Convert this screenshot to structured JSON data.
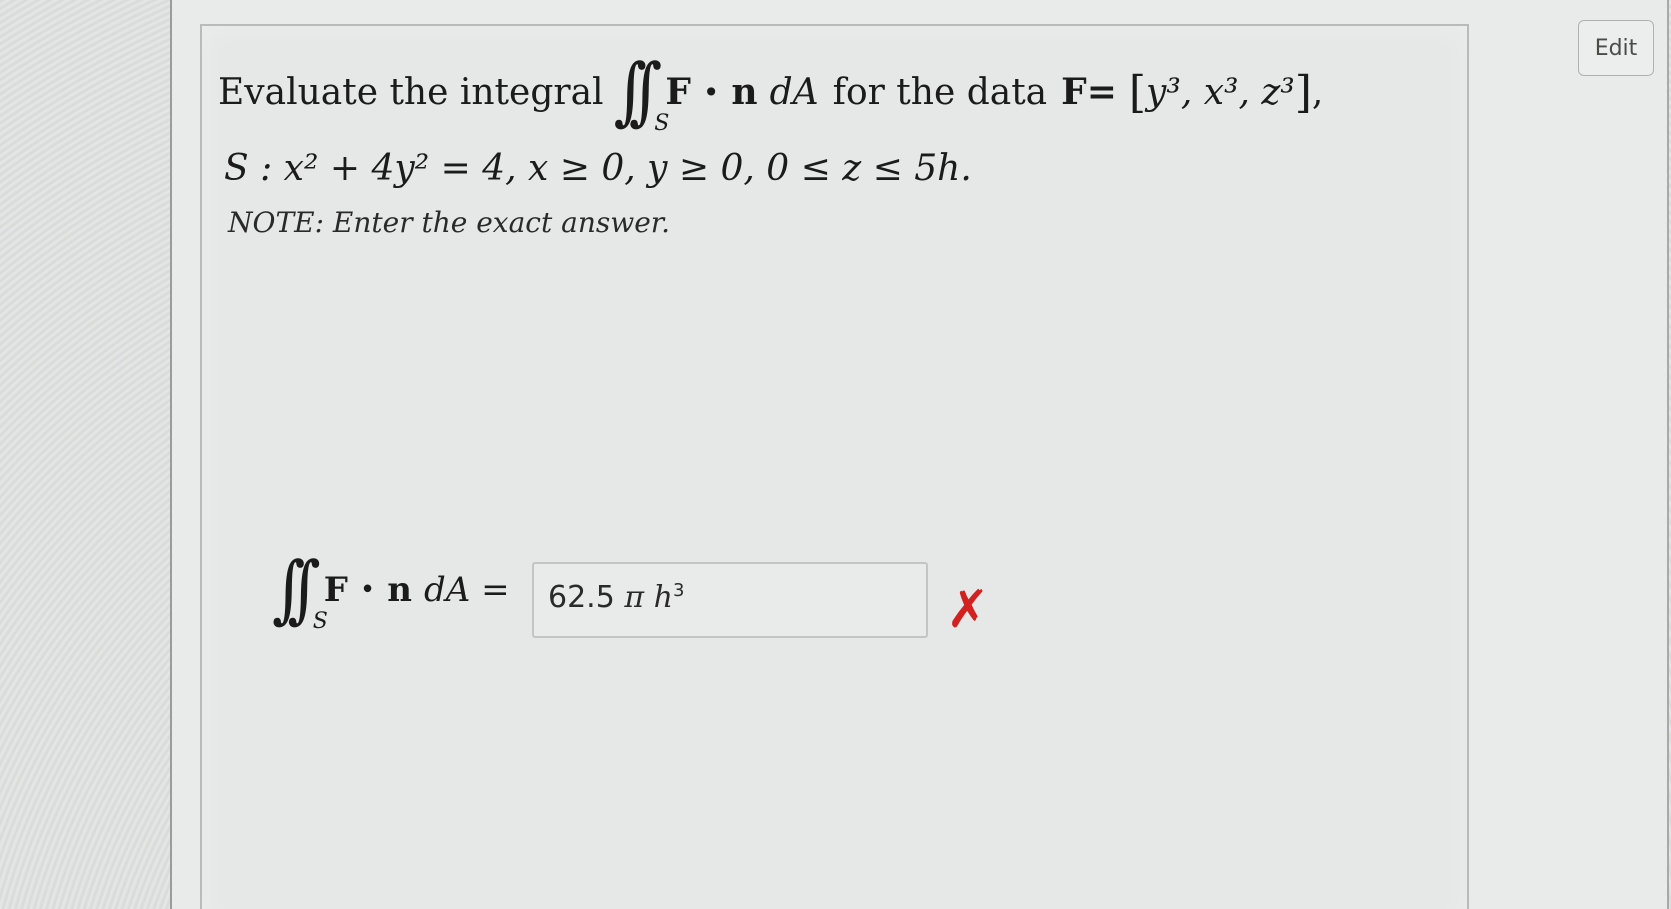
{
  "toolbar": {
    "edit_label": "Edit"
  },
  "question": {
    "prefix": "Evaluate the integral",
    "integral_sub": "S",
    "integrand_bold_F": "F",
    "dot": "•",
    "integrand_bold_n": "n",
    "dA": "dA",
    "middle_text": "for the data",
    "F_eq": "F=",
    "vector": "y³, x³, z³",
    "trailing_comma": ",",
    "surface_line": "S : x² + 4y² = 4, x ≥ 0, y ≥ 0, 0 ≤ z ≤ 5h.",
    "note": "NOTE: Enter the exact answer."
  },
  "answer": {
    "integral_sub": "S",
    "lhs_F": "F",
    "lhs_dot": "•",
    "lhs_n": "n",
    "lhs_dA": "dA =",
    "input_number": "62.5",
    "input_pi": "π",
    "input_h": "h",
    "input_exp": "3",
    "status_mark": "✗"
  },
  "colors": {
    "wrong": "#d2211f",
    "text": "#1b1b1b"
  }
}
